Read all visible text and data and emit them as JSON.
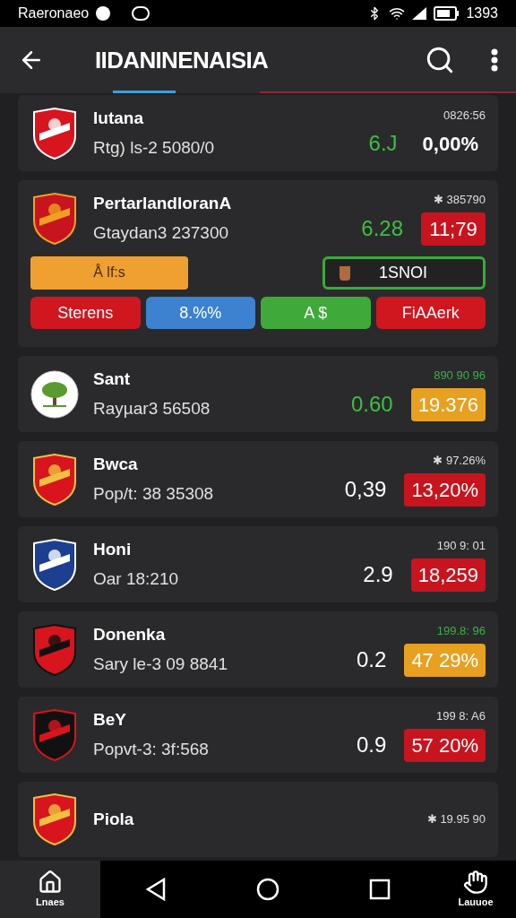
{
  "status_bar": {
    "carrier": "Raeronaeo",
    "time": "1393"
  },
  "app_bar": {
    "title": "IIDANINENAISIA"
  },
  "rows": [
    {
      "kind": "shield",
      "name": "Iutana",
      "sub": "Rtg) ls-2 5080/0",
      "top": "0826:56",
      "top_positive": false,
      "value": "6.J",
      "positive": true,
      "badge": "0,00%"
    },
    {
      "kind": "shield",
      "name": "PertarlandloranA",
      "sub": "Gtaydan3 237300",
      "top": "✱ 385790",
      "top_positive": false,
      "value": "6.28",
      "positive": true,
      "badge": "11;79",
      "color": "#c8141e",
      "panel": {
        "tag": "Å lf:s",
        "chip": "1SNOI",
        "buttons": [
          {
            "label": "Sterens",
            "color": "#d0161f"
          },
          {
            "label": "8.%%",
            "color": "#3c82d0"
          },
          {
            "label": "A   $",
            "color": "#3faa3a"
          },
          {
            "label": "FiAAerk",
            "color": "#d0161f"
          }
        ]
      }
    },
    {
      "kind": "round",
      "name": "Sant",
      "sub": "Rayµar3 56508",
      "top": "890 90 96",
      "top_positive": true,
      "value": "0.60",
      "positive": true,
      "badge": "19.376",
      "color": "#e8a021"
    },
    {
      "kind": "shield",
      "name": "Bwca",
      "sub": "Pop/t: 38 35308",
      "top": "✱ 97.26%",
      "top_positive": false,
      "value": "0,39",
      "positive": false,
      "badge": "13,20%",
      "color": "#c8141e"
    },
    {
      "kind": "shield",
      "name": "Honi",
      "sub": "Oar 18:210",
      "top": "190 9: 01",
      "top_positive": false,
      "value": "2.9",
      "positive": false,
      "badge": "18,259",
      "color": "#c8141e"
    },
    {
      "kind": "shield",
      "name": "Donenka",
      "sub": "Sary le-3 09 8841",
      "top": "199.8: 96",
      "top_positive": true,
      "value": "0.2",
      "positive": false,
      "badge": "47 29%",
      "color": "#e8a021"
    },
    {
      "kind": "shield",
      "name": "BeY",
      "sub": "Popvt-3: 3f:568",
      "top": "199 8: A6",
      "top_positive": false,
      "value": "0.9",
      "positive": false,
      "badge": "57 20%",
      "color": "#c8141e"
    },
    {
      "kind": "shield",
      "name": "Piola",
      "top": "✱ 19.95 90",
      "top_positive": false
    }
  ],
  "bottom_bar": {
    "left_label": "Lnaes",
    "right_label": "Lauuoe"
  }
}
